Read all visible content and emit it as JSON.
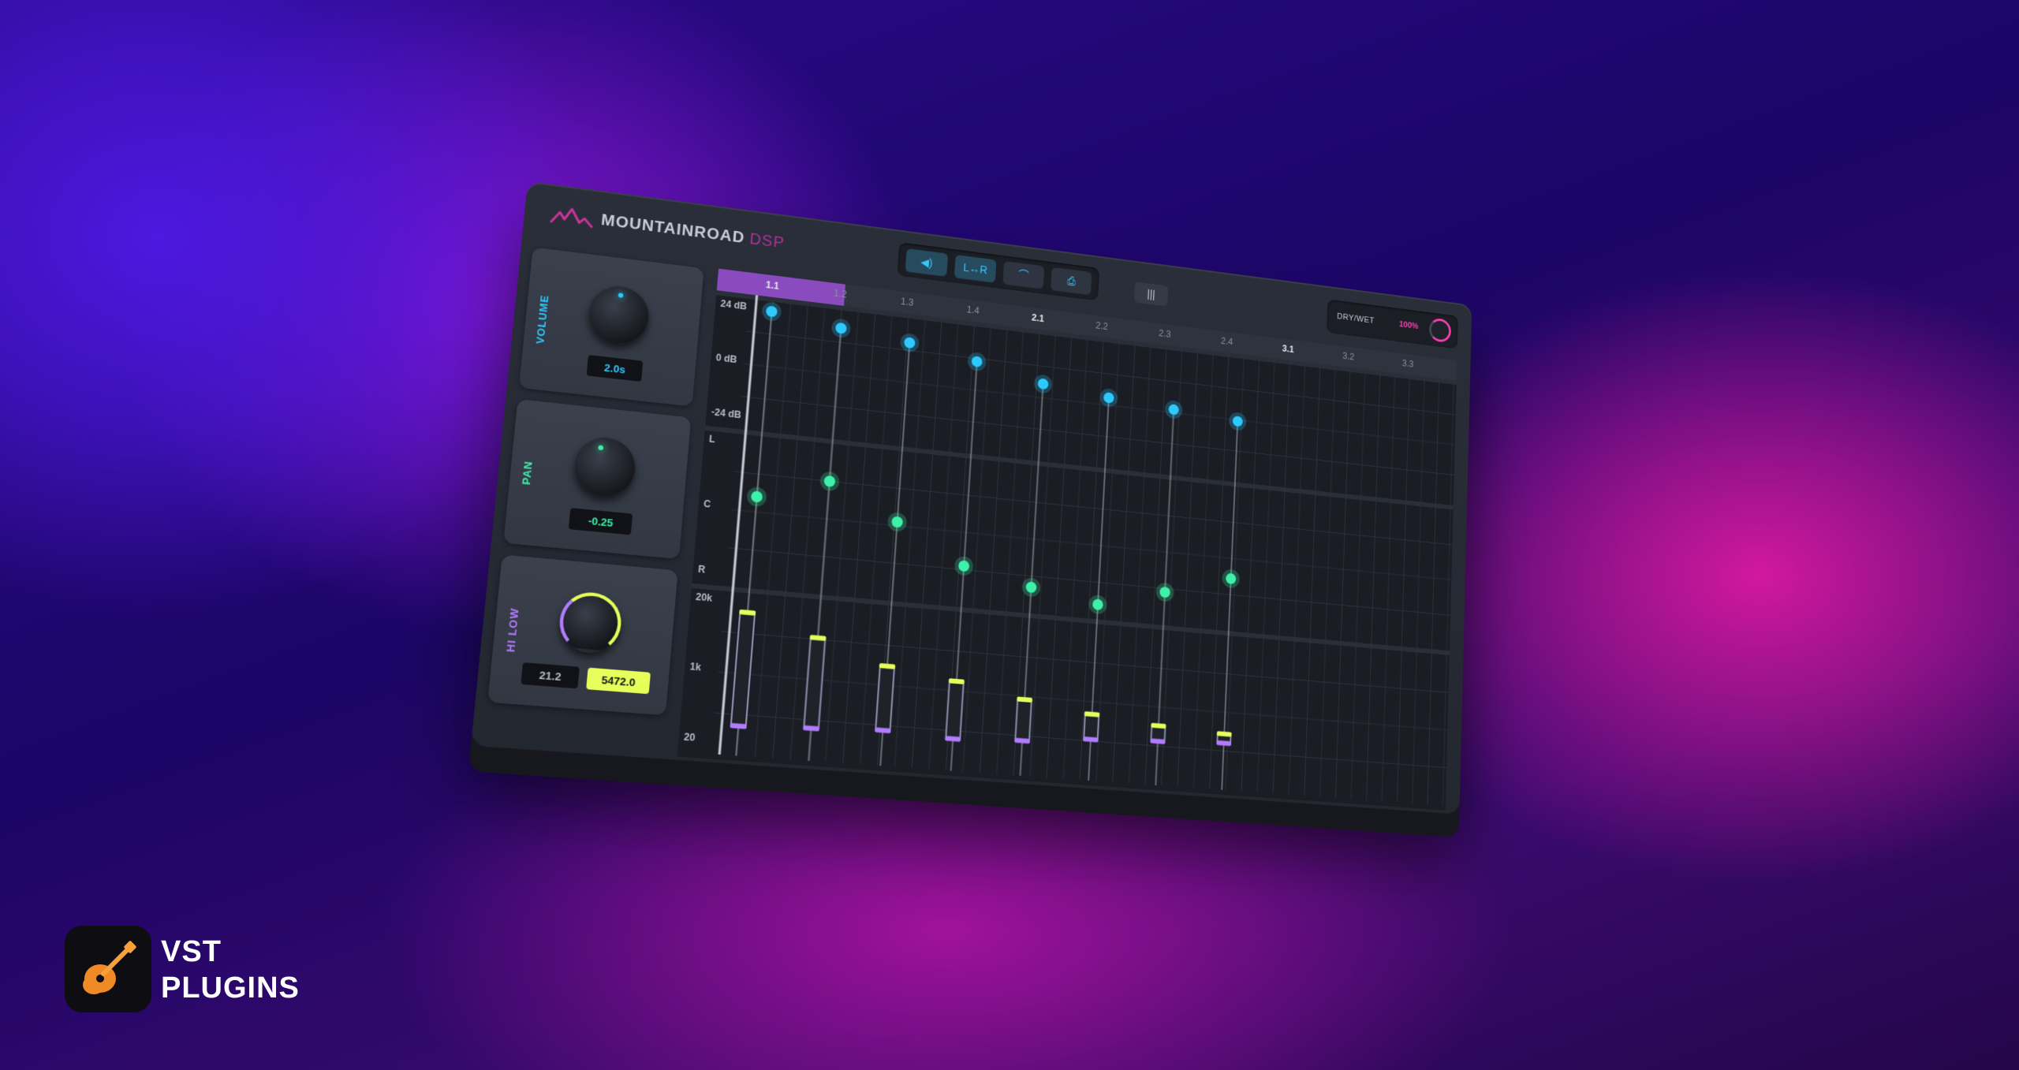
{
  "plugin": {
    "brand_name": "MOUNTAINROAD",
    "brand_suffix": "DSP",
    "toolbar": {
      "buttons": [
        {
          "icon": "speaker-icon",
          "glyph": "◀)"
        },
        {
          "icon": "link-icon",
          "label": "L↔R"
        },
        {
          "icon": "curve-icon",
          "glyph": "⌒"
        },
        {
          "icon": "camera-icon",
          "glyph": "⎙"
        }
      ],
      "mixer_glyph": "|||"
    },
    "dry_wet": {
      "label": "DRY/WET",
      "value": "100%"
    },
    "volume": {
      "label": "VOLUME",
      "value": "2.0s"
    },
    "pan": {
      "label": "PAN",
      "value": "-0.25"
    },
    "hilow": {
      "label": "HI LOW",
      "low_value": "21.2",
      "high_value": "5472.0"
    },
    "ruler": [
      "1.1",
      "1.2",
      "1.3",
      "1.4",
      "2.1",
      "2.2",
      "2.3",
      "2.4",
      "3.1",
      "3.2",
      "3.3"
    ],
    "lanes": {
      "volume": {
        "labels": [
          "24 dB",
          "0 dB",
          "-24 dB"
        ],
        "values": [
          0.85,
          0.72,
          0.62,
          0.45,
          0.22,
          0.12,
          0.05,
          -0.02
        ]
      },
      "pan": {
        "labels": [
          "L",
          "C",
          "R"
        ],
        "values": [
          0.2,
          0.5,
          0.05,
          -0.45,
          -0.65,
          -0.8,
          -0.55,
          -0.28
        ]
      },
      "hilow": {
        "labels": [
          "20k",
          "1k",
          "20"
        ],
        "ranges": [
          [
            0.18,
            0.88
          ],
          [
            0.2,
            0.76
          ],
          [
            0.22,
            0.62
          ],
          [
            0.2,
            0.56
          ],
          [
            0.22,
            0.48
          ],
          [
            0.26,
            0.42
          ],
          [
            0.28,
            0.38
          ],
          [
            0.3,
            0.36
          ]
        ]
      }
    },
    "colors": {
      "cyan": "#2ec9ff",
      "green": "#3ff0a8",
      "yellow": "#e6ff5a",
      "purple": "#b27cff",
      "magenta": "#ff3fb4"
    }
  },
  "watermark": {
    "line1": "VST",
    "line2": "PLUGINS",
    "icon": "guitar-icon"
  }
}
